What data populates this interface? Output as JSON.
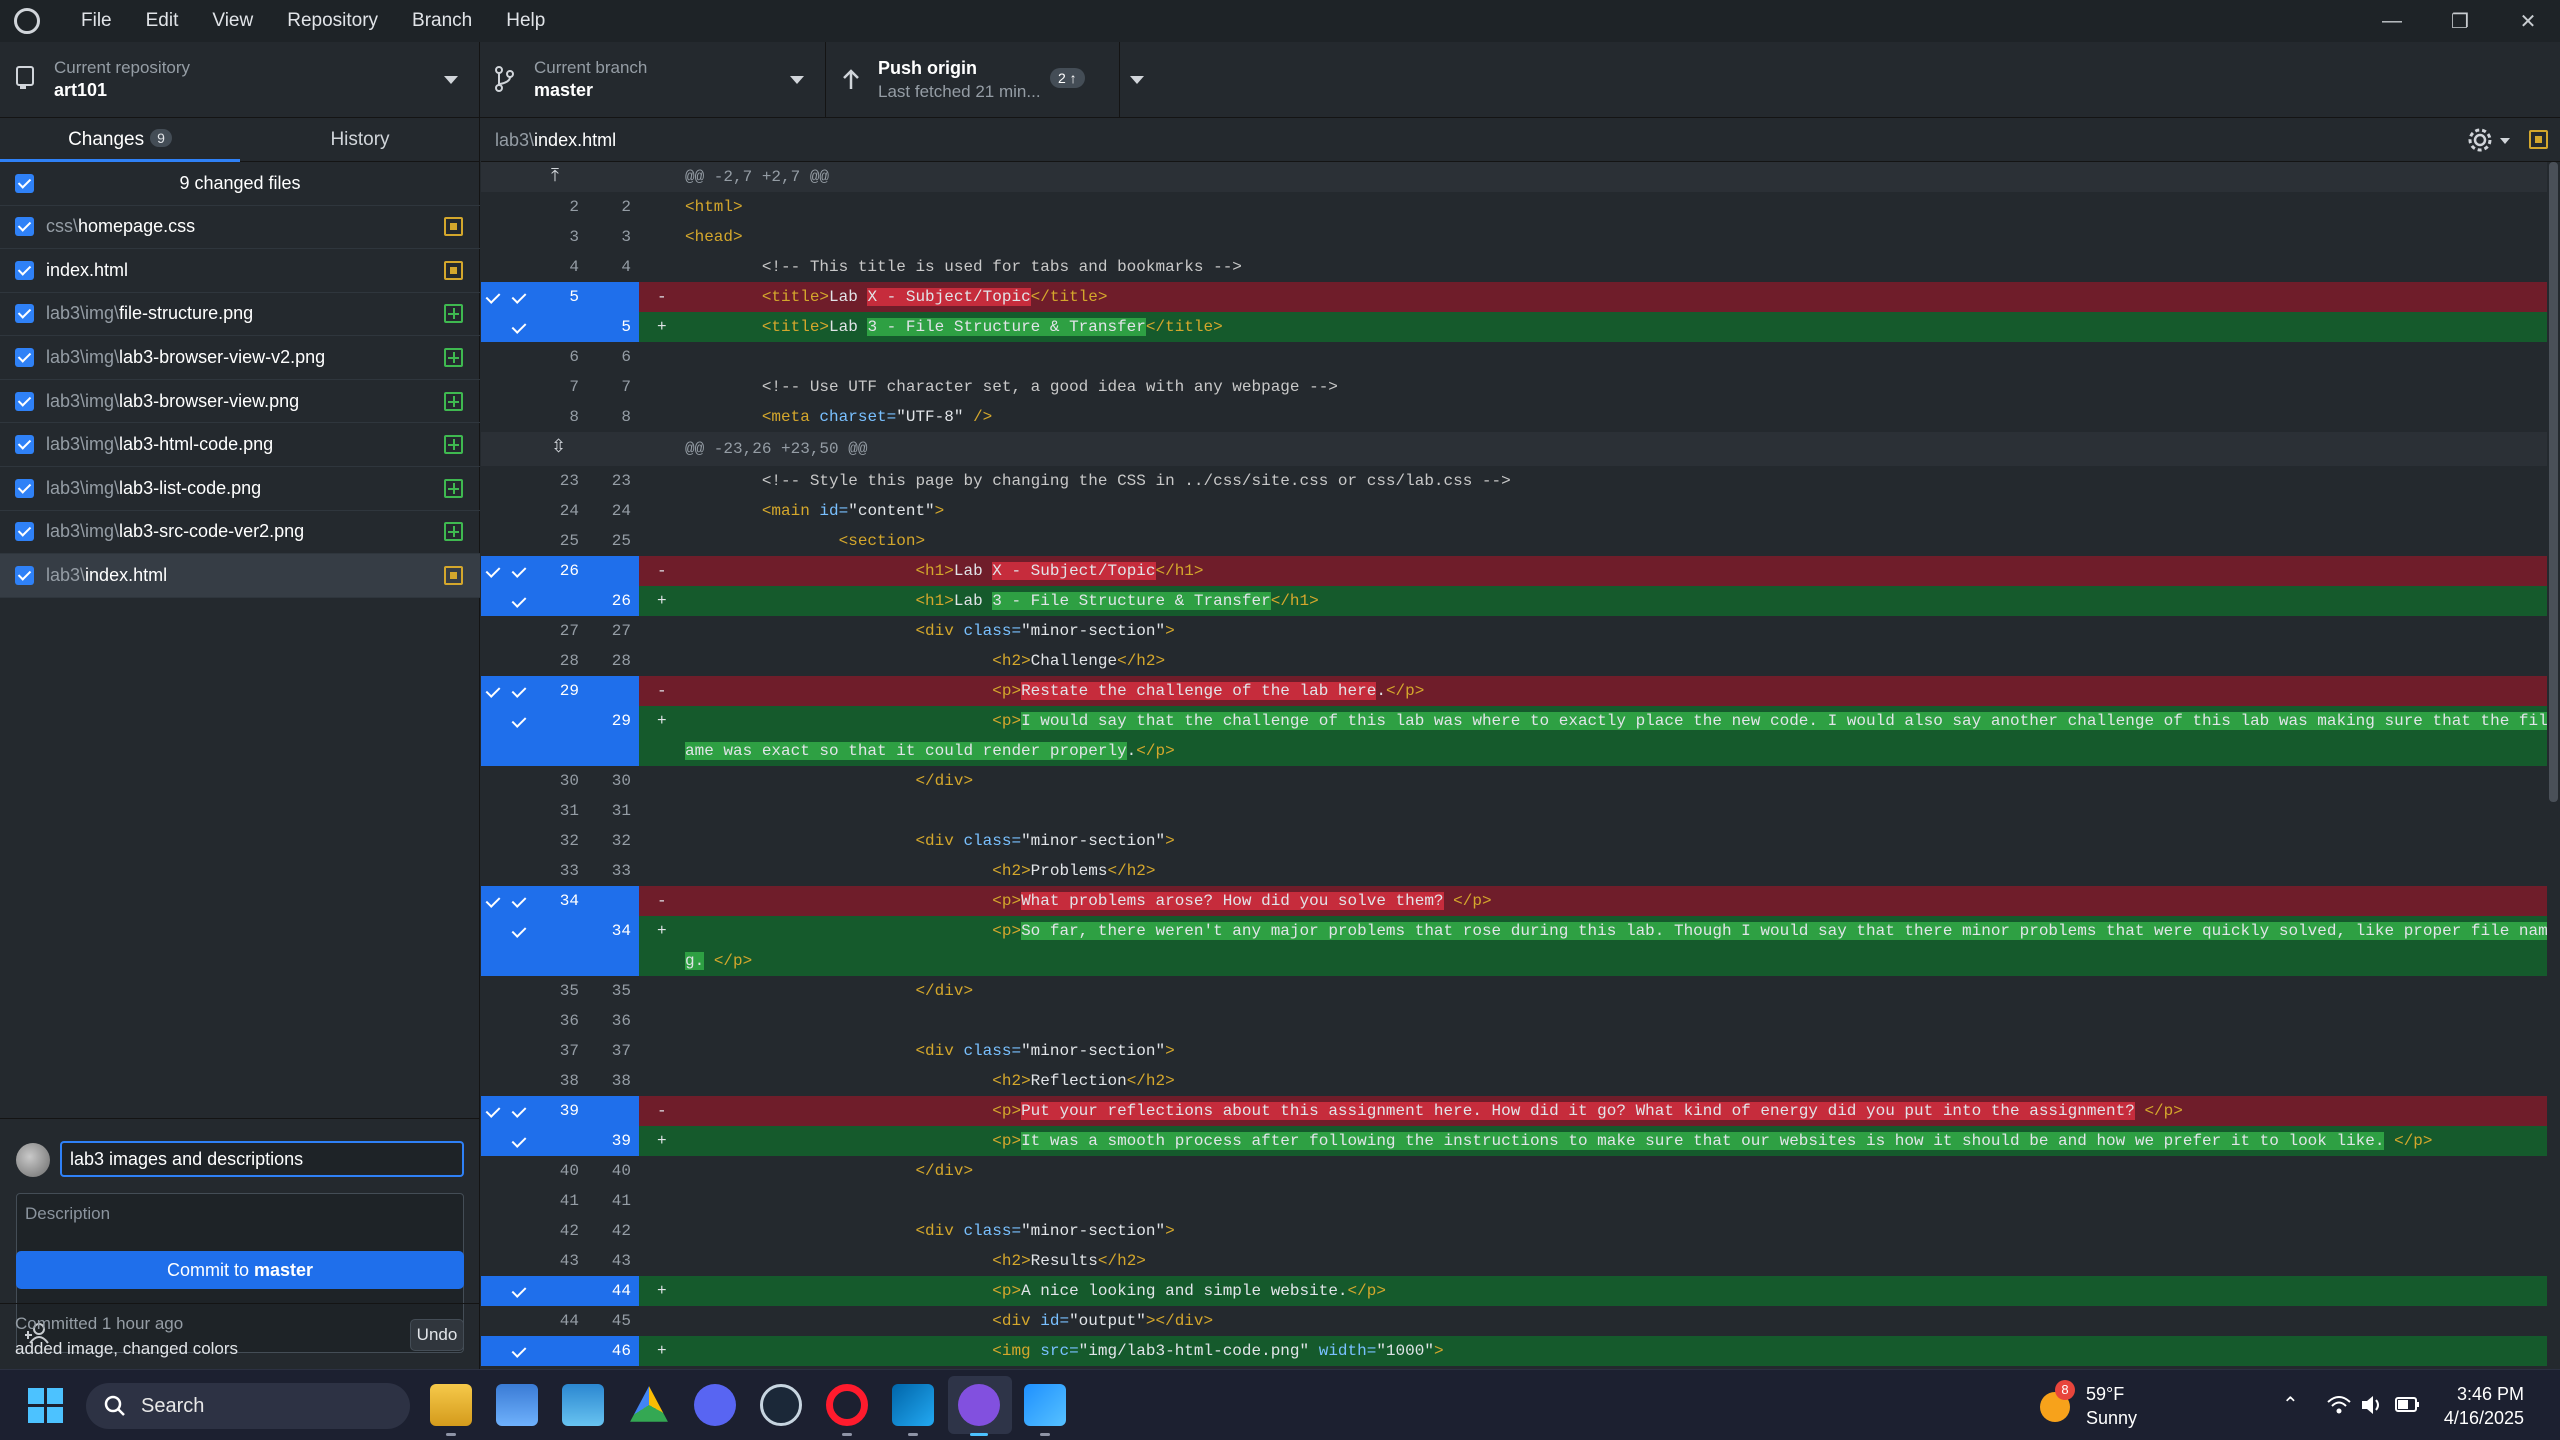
{
  "menu": [
    "File",
    "Edit",
    "View",
    "Repository",
    "Branch",
    "Help"
  ],
  "toolbar": {
    "repo_label": "Current repository",
    "repo_value": "art101",
    "branch_label": "Current branch",
    "branch_value": "master",
    "push_label": "Push origin",
    "push_sub": "Last fetched 21 min...",
    "push_count": "2"
  },
  "tabs": {
    "changes": "Changes",
    "changes_count": "9",
    "history": "History"
  },
  "changes_header": "9 changed files",
  "files": [
    {
      "dir": "css\\",
      "name": "homepage.css",
      "status": "modified"
    },
    {
      "dir": "",
      "name": "index.html",
      "status": "modified"
    },
    {
      "dir": "lab3\\img\\",
      "name": "file-structure.png",
      "status": "added"
    },
    {
      "dir": "lab3\\img\\",
      "name": "lab3-browser-view-v2.png",
      "status": "added"
    },
    {
      "dir": "lab3\\img\\",
      "name": "lab3-browser-view.png",
      "status": "added"
    },
    {
      "dir": "lab3\\img\\",
      "name": "lab3-html-code.png",
      "status": "added"
    },
    {
      "dir": "lab3\\img\\",
      "name": "lab3-list-code.png",
      "status": "added"
    },
    {
      "dir": "lab3\\img\\",
      "name": "lab3-src-code-ver2.png",
      "status": "added"
    },
    {
      "dir": "lab3\\",
      "name": "index.html",
      "status": "modified"
    }
  ],
  "commit": {
    "summary": "lab3 images and descriptions",
    "description_placeholder": "Description",
    "button_prefix": "Commit to ",
    "button_branch": "master",
    "last_committed": "Committed 1 hour ago",
    "last_message": "added image, changed colors",
    "undo": "Undo"
  },
  "diff": {
    "path_dir": "lab3\\",
    "path_file": "index.html",
    "lines": [
      {
        "t": "hunk",
        "h": 30,
        "code": "@@ -2,7 +2,7 @@"
      },
      {
        "t": "ctx",
        "o": "2",
        "n": "2",
        "code": "<html>"
      },
      {
        "t": "ctx",
        "o": "3",
        "n": "3",
        "code": "<head>"
      },
      {
        "t": "ctx",
        "o": "4",
        "n": "4",
        "code": "        <!-- This title is used for tabs and bookmarks -->"
      },
      {
        "t": "del",
        "o": "5",
        "n": "",
        "pre": "        <title>Lab ",
        "hl": "X - Subject/Topic",
        "post": "</title>"
      },
      {
        "t": "add",
        "o": "",
        "n": "5",
        "pre": "        <title>Lab ",
        "hl": "3 - File Structure & Transfer",
        "post": "</title>"
      },
      {
        "t": "ctx",
        "o": "6",
        "n": "6",
        "code": ""
      },
      {
        "t": "ctx",
        "o": "7",
        "n": "7",
        "code": "        <!-- Use UTF character set, a good idea with any webpage -->"
      },
      {
        "t": "ctx",
        "o": "8",
        "n": "8",
        "code": "        <meta charset=\"UTF-8\" />"
      },
      {
        "t": "hunk",
        "h": 34,
        "code": "@@ -23,26 +23,50 @@"
      },
      {
        "t": "ctx",
        "o": "23",
        "n": "23",
        "code": "        <!-- Style this page by changing the CSS in ../css/site.css or css/lab.css -->"
      },
      {
        "t": "ctx",
        "o": "24",
        "n": "24",
        "code": "        <main id=\"content\">"
      },
      {
        "t": "ctx",
        "o": "25",
        "n": "25",
        "code": "                <section>"
      },
      {
        "t": "del",
        "o": "26",
        "n": "",
        "pre": "                        <h1>Lab ",
        "hl": "X - Subject/Topic",
        "post": "</h1>"
      },
      {
        "t": "add",
        "o": "",
        "n": "26",
        "pre": "                        <h1>Lab ",
        "hl": "3 - File Structure & Transfer",
        "post": "</h1>"
      },
      {
        "t": "ctx",
        "o": "27",
        "n": "27",
        "code": "                        <div class=\"minor-section\">"
      },
      {
        "t": "ctx",
        "o": "28",
        "n": "28",
        "code": "                                <h2>Challenge</h2>"
      },
      {
        "t": "del",
        "o": "29",
        "n": "",
        "pre": "                                <p>",
        "hl": "Restate the challenge of the lab here",
        "post": ".</p>"
      },
      {
        "t": "add",
        "o": "",
        "n": "29",
        "h": 60,
        "pre": "                                <p>",
        "hl": "I would say that the challenge of this lab was where to exactly place the new code. I would also say another challenge of this lab was making sure that the file n",
        "post": "",
        "cont_hl": "ame was exact so that it could render properly",
        "cont_post": ".</p>"
      },
      {
        "t": "ctx",
        "o": "30",
        "n": "30",
        "code": "                        </div>"
      },
      {
        "t": "ctx",
        "o": "31",
        "n": "31",
        "code": ""
      },
      {
        "t": "ctx",
        "o": "32",
        "n": "32",
        "code": "                        <div class=\"minor-section\">"
      },
      {
        "t": "ctx",
        "o": "33",
        "n": "33",
        "code": "                                <h2>Problems</h2>"
      },
      {
        "t": "del",
        "o": "34",
        "n": "",
        "pre": "                                <p>",
        "hl": "What problems arose? How did you solve them?",
        "post": " </p>"
      },
      {
        "t": "add",
        "o": "",
        "n": "34",
        "h": 60,
        "pre": "                                <p>",
        "hl": "So far, there weren't any major problems that rose during this lab. Though I would say that there minor problems that were quickly solved, like proper file namin",
        "post": "",
        "cont_hl": "g.",
        "cont_post": " </p>"
      },
      {
        "t": "ctx",
        "o": "35",
        "n": "35",
        "code": "                        </div>"
      },
      {
        "t": "ctx",
        "o": "36",
        "n": "36",
        "code": ""
      },
      {
        "t": "ctx",
        "o": "37",
        "n": "37",
        "code": "                        <div class=\"minor-section\">"
      },
      {
        "t": "ctx",
        "o": "38",
        "n": "38",
        "code": "                                <h2>Reflection</h2>"
      },
      {
        "t": "del",
        "o": "39",
        "n": "",
        "pre": "                                <p>",
        "hl": "Put your reflections about this assignment here. How did it go? What kind of energy did you put into the assignment?",
        "post": " </p>"
      },
      {
        "t": "add",
        "o": "",
        "n": "39",
        "pre": "                                <p>",
        "hl": "It was a smooth process after following the instructions to make sure that our websites is how it should be and how we prefer it to look like.",
        "post": " </p>"
      },
      {
        "t": "ctx",
        "o": "40",
        "n": "40",
        "code": "                        </div>"
      },
      {
        "t": "ctx",
        "o": "41",
        "n": "41",
        "code": ""
      },
      {
        "t": "ctx",
        "o": "42",
        "n": "42",
        "code": "                        <div class=\"minor-section\">"
      },
      {
        "t": "ctx",
        "o": "43",
        "n": "43",
        "code": "                                <h2>Results</h2>"
      },
      {
        "t": "add",
        "o": "",
        "n": "44",
        "pre": "                                <p>A nice looking and simple website.</p>",
        "hl": "",
        "post": ""
      },
      {
        "t": "ctx",
        "o": "44",
        "n": "45",
        "code": "                                <div id=\"output\"></div>"
      },
      {
        "t": "add",
        "o": "",
        "n": "46",
        "pre": "                                <img src=\"img/lab3-html-code.png\" width=\"1000\">",
        "hl": "",
        "post": ""
      }
    ]
  },
  "taskbar": {
    "search": "Search",
    "weather_temp": "59°F",
    "weather_desc": "Sunny",
    "weather_badge": "8",
    "time": "3:46 PM",
    "date": "4/16/2025"
  },
  "colors": {
    "accent": "#1f6feb",
    "added": "#2ea043",
    "removed": "#c62c3c",
    "modified": "#d4a72c"
  }
}
